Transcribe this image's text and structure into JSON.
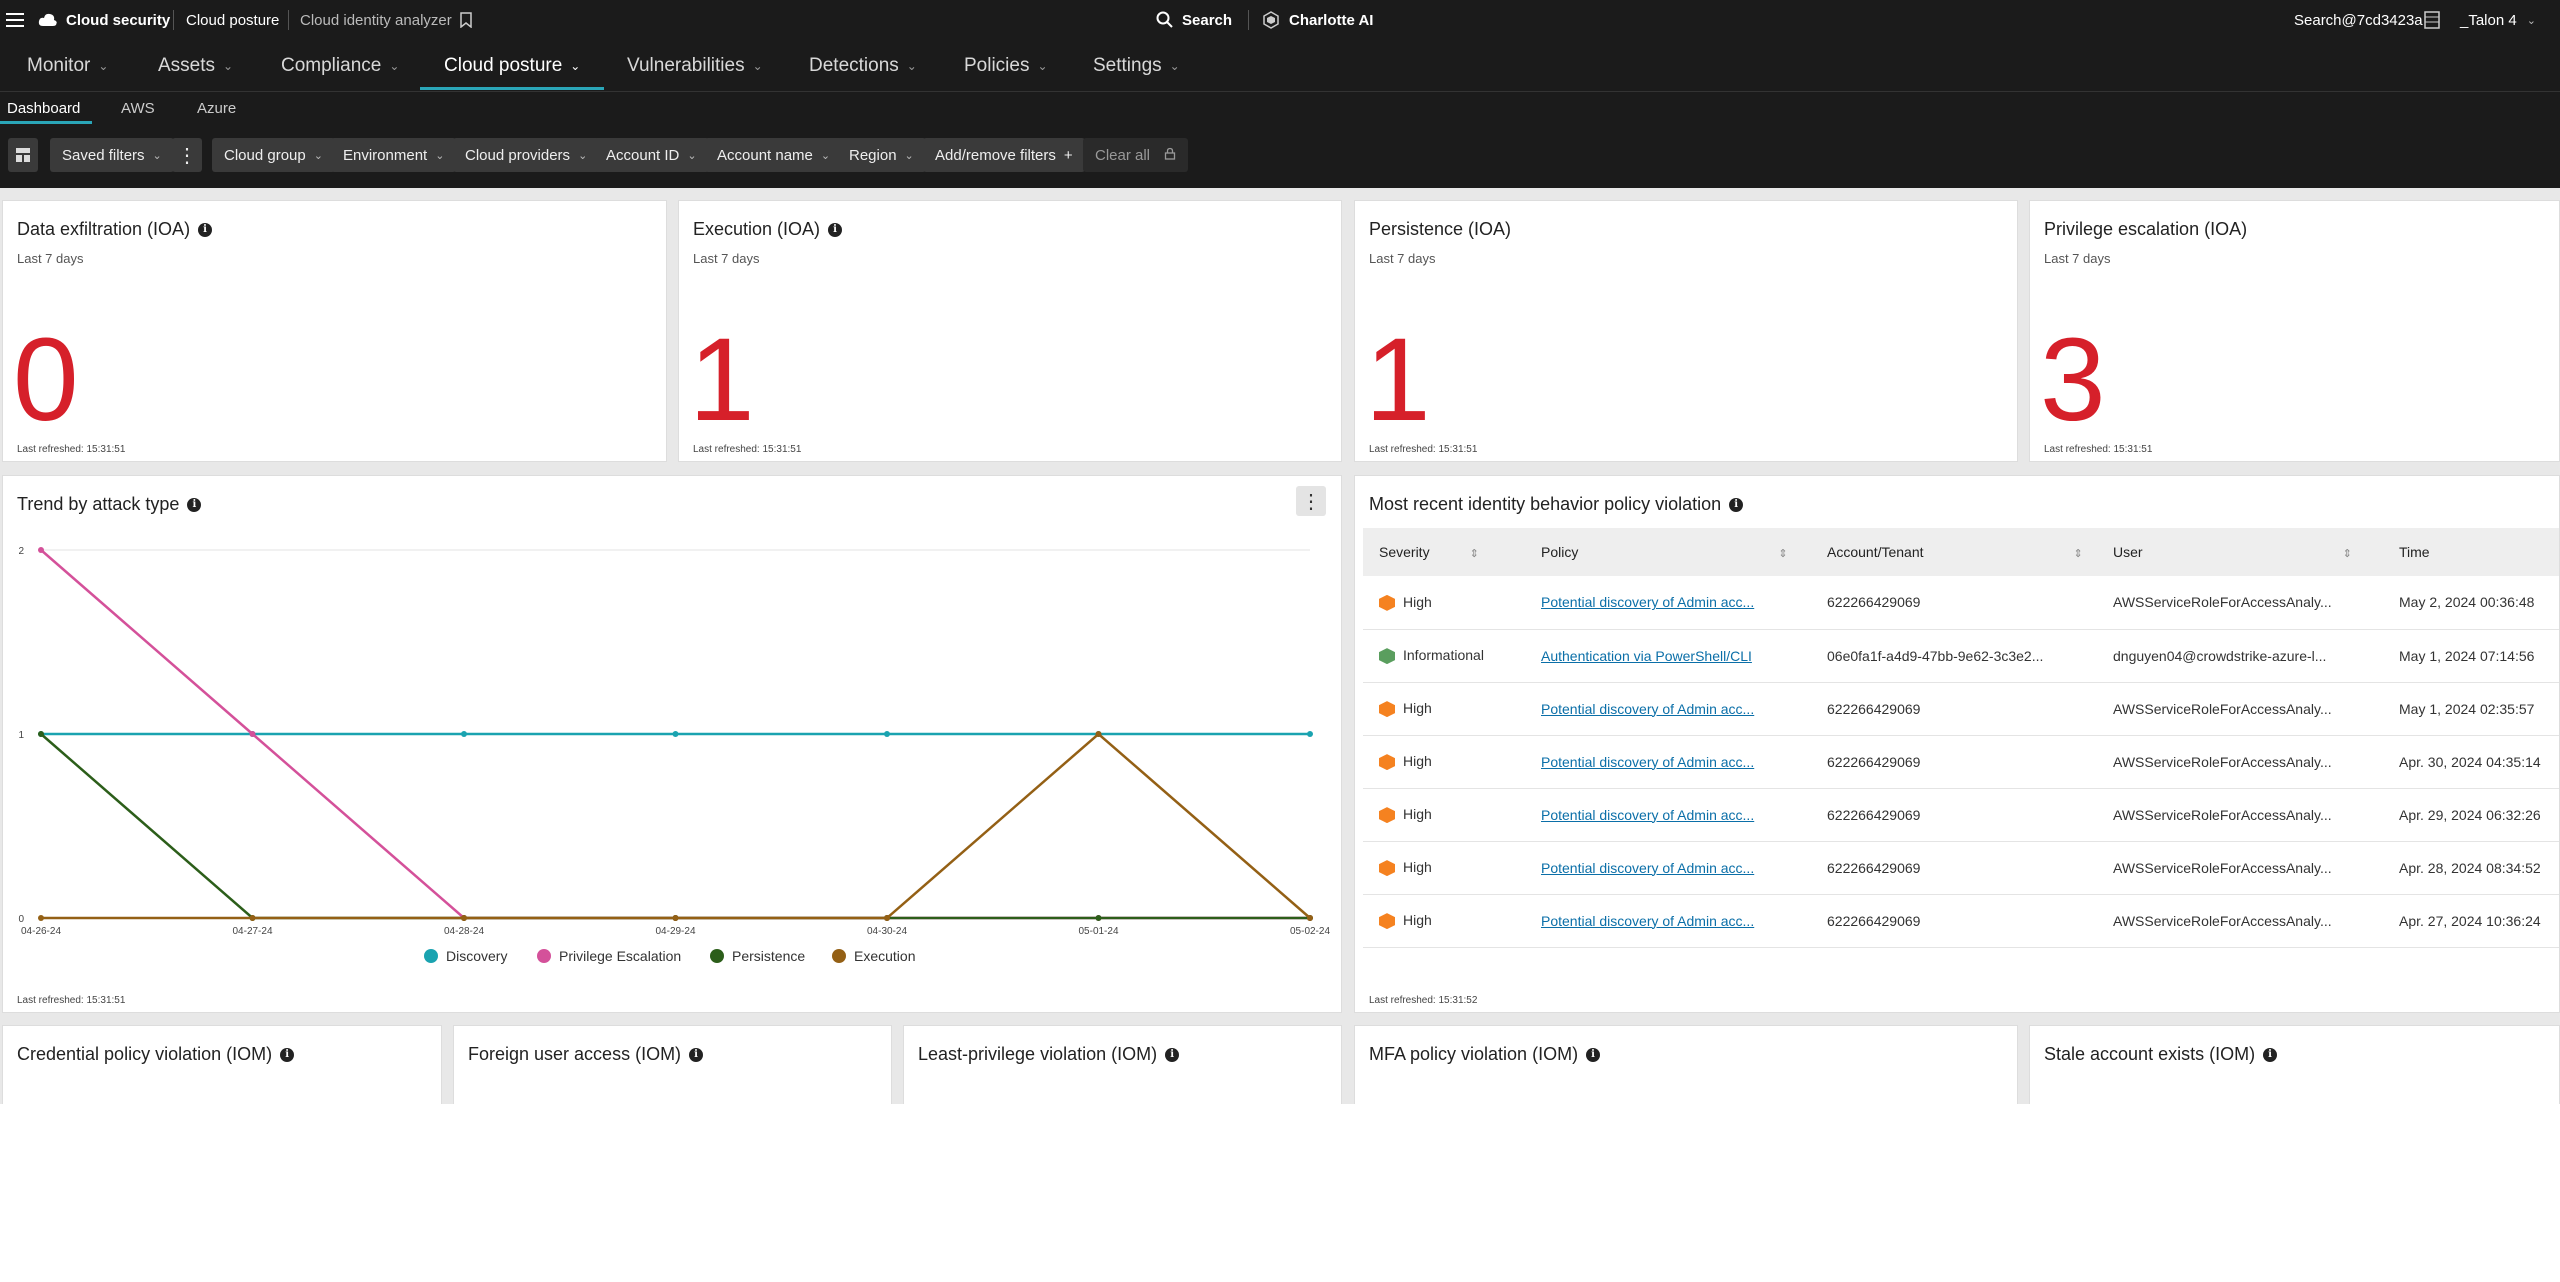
{
  "topbar": {
    "app_name": "Cloud security",
    "breadcrumb_1": "Cloud posture",
    "breadcrumb_2": "Cloud identity analyzer",
    "search_label": "Search",
    "ai_label": "Charlotte AI",
    "user_label": "Search@7cd3423a",
    "tenant_label": "_Talon 4"
  },
  "nav": {
    "items": [
      {
        "label": "Monitor"
      },
      {
        "label": "Assets"
      },
      {
        "label": "Compliance"
      },
      {
        "label": "Cloud posture"
      },
      {
        "label": "Vulnerabilities"
      },
      {
        "label": "Detections"
      },
      {
        "label": "Policies"
      },
      {
        "label": "Settings"
      }
    ],
    "active": "Cloud posture"
  },
  "subnav": {
    "tabs": [
      {
        "label": "Dashboard"
      },
      {
        "label": "AWS"
      },
      {
        "label": "Azure"
      }
    ],
    "active": "Dashboard"
  },
  "filters": {
    "saved_filters": "Saved filters",
    "items": [
      {
        "label": "Cloud group"
      },
      {
        "label": "Environment"
      },
      {
        "label": "Cloud providers"
      },
      {
        "label": "Account ID"
      },
      {
        "label": "Account name"
      },
      {
        "label": "Region"
      }
    ],
    "add_remove": "Add/remove filters",
    "clear_all": "Clear all"
  },
  "ioa_cards": [
    {
      "title": "Data exfiltration (IOA)",
      "period": "Last 7 days",
      "value": "0",
      "refreshed": "Last refreshed: 15:31:51"
    },
    {
      "title": "Execution (IOA)",
      "period": "Last 7 days",
      "value": "1",
      "refreshed": "Last refreshed: 15:31:51"
    },
    {
      "title": "Persistence (IOA)",
      "period": "Last 7 days",
      "value": "1",
      "refreshed": "Last refreshed: 15:31:51"
    },
    {
      "title": "Privilege escalation (IOA)",
      "period": "Last 7 days",
      "value": "3",
      "refreshed": "Last refreshed: 15:31:51"
    }
  ],
  "trend": {
    "title": "Trend by attack type",
    "refreshed": "Last refreshed: 15:31:51"
  },
  "chart_data": {
    "type": "line",
    "title": "Trend by attack type",
    "x": [
      "04-26-24",
      "04-27-24",
      "04-28-24",
      "04-29-24",
      "04-30-24",
      "05-01-24",
      "05-02-24"
    ],
    "ylim": [
      0,
      2
    ],
    "yticks": [
      "0",
      "1",
      "2"
    ],
    "grid": true,
    "legend": "bottom",
    "series": [
      {
        "name": "Discovery",
        "color": "#1aa3b0",
        "values": [
          1,
          1,
          1,
          1,
          1,
          1,
          1
        ]
      },
      {
        "name": "Privilege Escalation",
        "color": "#d4519a",
        "values": [
          2,
          1,
          0,
          0,
          0,
          0,
          0
        ]
      },
      {
        "name": "Persistence",
        "color": "#2c5e1a",
        "values": [
          1,
          0,
          0,
          0,
          0,
          0,
          0
        ]
      },
      {
        "name": "Execution",
        "color": "#946015",
        "values": [
          0,
          0,
          0,
          0,
          0,
          1,
          0
        ]
      }
    ]
  },
  "violations": {
    "title": "Most recent identity behavior policy violation",
    "refreshed": "Last refreshed: 15:31:52",
    "columns": [
      "Severity",
      "Policy",
      "Account/Tenant",
      "User",
      "Time"
    ],
    "rows": [
      {
        "severity": "High",
        "sev_color": "#f58220",
        "policy": "Potential discovery of Admin acc...",
        "account": "622266429069",
        "user": "AWSServiceRoleForAccessAnaly...",
        "time": "May 2, 2024 00:36:48"
      },
      {
        "severity": "Informational",
        "sev_color": "#5a9e5e",
        "policy": "Authentication via PowerShell/CLI",
        "account": "06e0fa1f-a4d9-47bb-9e62-3c3e2...",
        "user": "dnguyen04@crowdstrike-azure-l...",
        "time": "May 1, 2024 07:14:56"
      },
      {
        "severity": "High",
        "sev_color": "#f58220",
        "policy": "Potential discovery of Admin acc...",
        "account": "622266429069",
        "user": "AWSServiceRoleForAccessAnaly...",
        "time": "May 1, 2024 02:35:57"
      },
      {
        "severity": "High",
        "sev_color": "#f58220",
        "policy": "Potential discovery of Admin acc...",
        "account": "622266429069",
        "user": "AWSServiceRoleForAccessAnaly...",
        "time": "Apr. 30, 2024 04:35:14"
      },
      {
        "severity": "High",
        "sev_color": "#f58220",
        "policy": "Potential discovery of Admin acc...",
        "account": "622266429069",
        "user": "AWSServiceRoleForAccessAnaly...",
        "time": "Apr. 29, 2024 06:32:26"
      },
      {
        "severity": "High",
        "sev_color": "#f58220",
        "policy": "Potential discovery of Admin acc...",
        "account": "622266429069",
        "user": "AWSServiceRoleForAccessAnaly...",
        "time": "Apr. 28, 2024 08:34:52"
      },
      {
        "severity": "High",
        "sev_color": "#f58220",
        "policy": "Potential discovery of Admin acc...",
        "account": "622266429069",
        "user": "AWSServiceRoleForAccessAnaly...",
        "time": "Apr. 27, 2024 10:36:24"
      }
    ]
  },
  "iom_cards": [
    {
      "title": "Credential policy violation (IOM)"
    },
    {
      "title": "Foreign user access (IOM)"
    },
    {
      "title": "Least-privilege violation (IOM)"
    },
    {
      "title": "MFA policy violation (IOM)"
    },
    {
      "title": "Stale account exists (IOM)"
    }
  ]
}
